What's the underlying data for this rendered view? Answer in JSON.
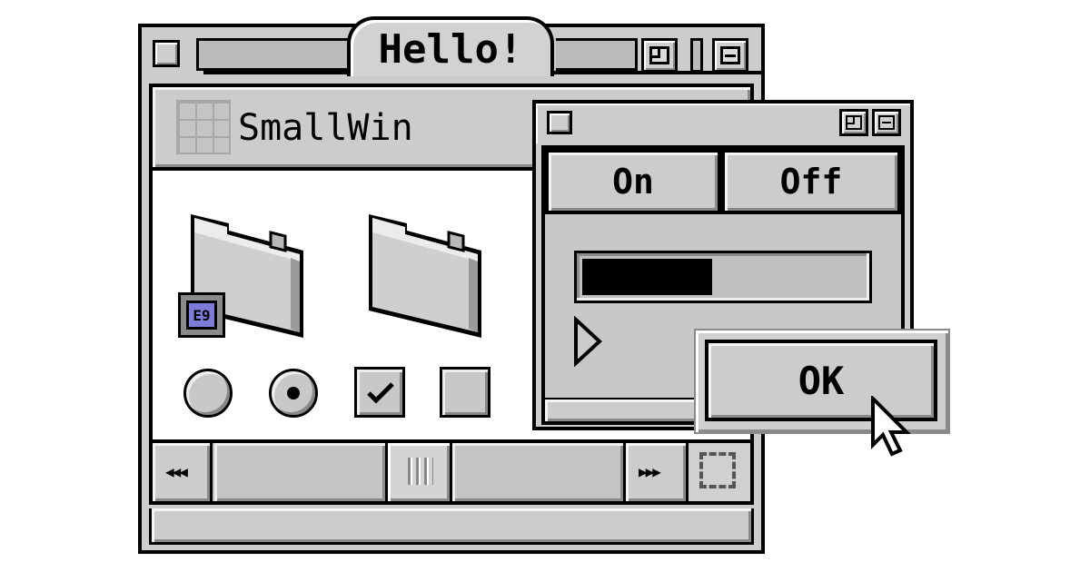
{
  "main_window": {
    "title": "Hello!",
    "header_label": "SmallWin",
    "radio_checked": true,
    "checkbox_checked": true
  },
  "small_window": {
    "on_label": "On",
    "off_label": "Off",
    "progress": 0.46
  },
  "dialog": {
    "ok_label": "OK"
  },
  "icons": {
    "app_badge": "app-badge-icon",
    "grid": "grid-icon"
  },
  "colors": {
    "chrome": "#cccccc",
    "progress_fill": "#000000",
    "badge": "#7c7cd8"
  }
}
